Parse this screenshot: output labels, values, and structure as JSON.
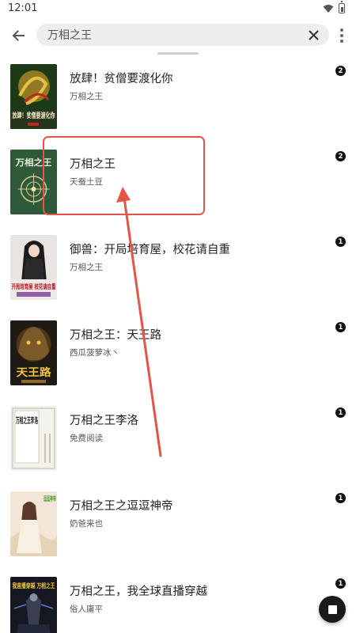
{
  "status_bar": {
    "time": "12:01"
  },
  "search": {
    "query": "万相之王"
  },
  "results": [
    {
      "title": "放肆！贫僧要渡化你",
      "author": "万相之王",
      "badge": "2",
      "cover_text": "放肆！贫僧要渡化你",
      "cover": "cover-dragon"
    },
    {
      "title": "万相之王",
      "author": "天蚕土豆",
      "badge": "2",
      "cover_text": "万相之王",
      "cover": "cover-green"
    },
    {
      "title": "御兽：开局培育屋，校花请自重",
      "author": "万相之王",
      "badge": "1",
      "cover_text": "开局培育屋 校花请自重",
      "cover": "cover-girl"
    },
    {
      "title": "万相之王：天王路",
      "author": "西瓜菠萝冰丶",
      "badge": "1",
      "cover_text": "天王路",
      "cover": "cover-beast"
    },
    {
      "title": "万相之王李洛",
      "author": "免费阅读",
      "badge": "1",
      "cover_text": "万相之王李洛",
      "cover": "cover-paper"
    },
    {
      "title": "万相之王之逗逗神帝",
      "author": "奶爸来也",
      "badge": "1",
      "cover_text": "逗逗神帝",
      "cover": "cover-fairy"
    },
    {
      "title": "万相之王，我全球直播穿越",
      "author": "俗人庸平",
      "badge": "1",
      "cover_text": "我直播穿越 万相之王",
      "cover": "cover-dark"
    }
  ],
  "annotation": {
    "color": "#e15645"
  }
}
